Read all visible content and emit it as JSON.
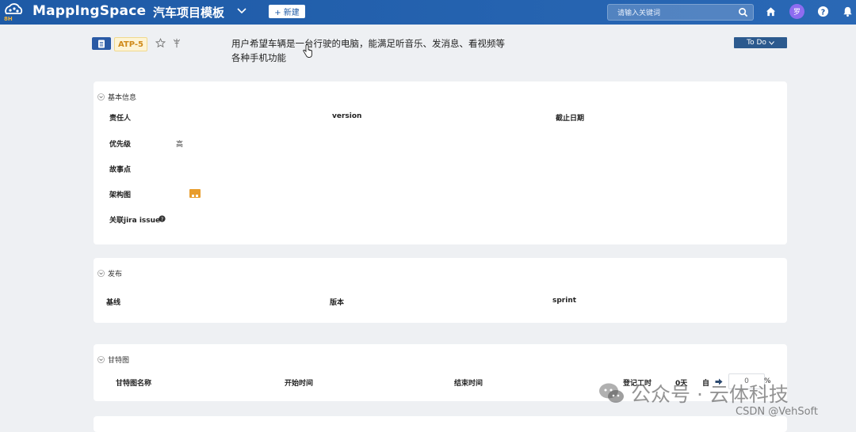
{
  "topbar": {
    "brand": "MappIngSpace",
    "project_title": "汽车项目模板",
    "new_button": "+ 新建",
    "search_placeholder": "请输入关键词",
    "avatar_text": "罗",
    "colors": {
      "bar": "#1e5aa6",
      "avatar": "#8e6cf0"
    }
  },
  "issue": {
    "key": "ATP-5",
    "summary_line1": "用户希望车辆是一台行驶的电脑，能满足听音乐、发消息、看视频等",
    "summary_line2": "各种手机功能",
    "status": "To Do"
  },
  "basic_info": {
    "title": "基本信息",
    "owner_label": "责任人",
    "version_label": "version",
    "deadline_label": "截止日期",
    "priority_label": "优先级",
    "priority_value": "高",
    "story_points_label": "故事点",
    "architecture_label": "架构图",
    "jira_label": "关联jira issue"
  },
  "release": {
    "title": "发布",
    "baseline_label": "基线",
    "version_label": "版本",
    "sprint_label": "sprint"
  },
  "gantt": {
    "title": "甘特图",
    "name_label": "甘特图名称",
    "start_label": "开始时间",
    "end_label": "结束时间",
    "logged_label": "登记工时",
    "logged_value": "0天",
    "extra_label": "自",
    "progress_value": "0",
    "percent_sign": "%"
  },
  "watermark": {
    "text": "公众号 · 云体科技",
    "csdn": "CSDN @VehSoft"
  }
}
